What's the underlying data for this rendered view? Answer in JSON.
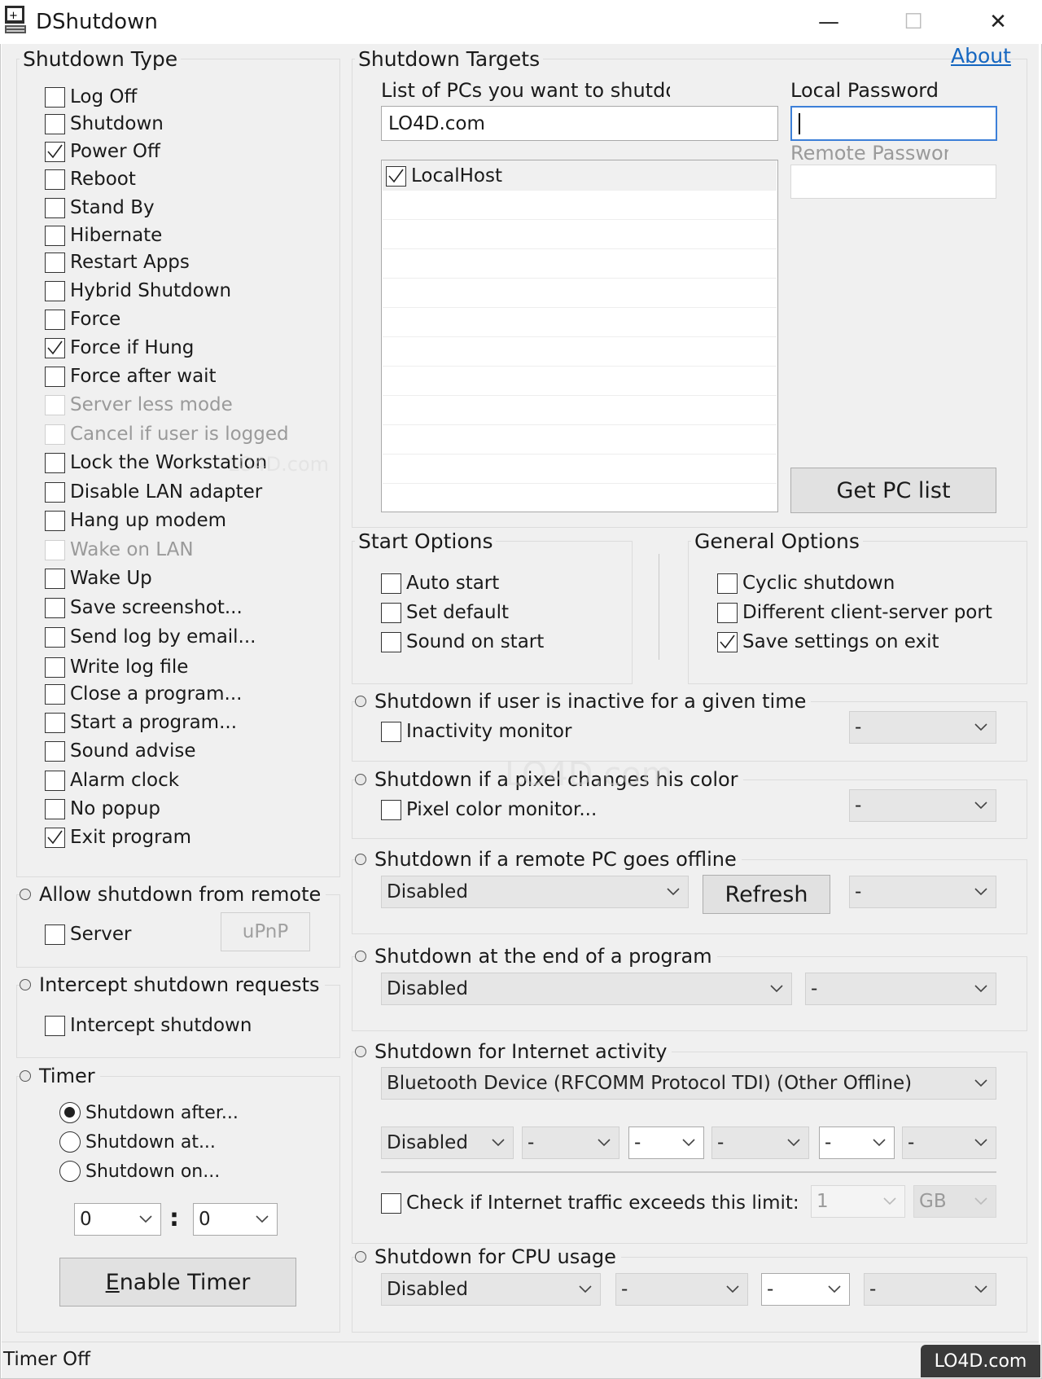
{
  "window": {
    "title": "DShutdown",
    "minimize_glyph": "—",
    "maximize_glyph": "☐",
    "close_glyph": "✕"
  },
  "shutdown_type": {
    "title": "Shutdown Type",
    "items": [
      {
        "label": "Log Off",
        "checked": false,
        "disabled": false
      },
      {
        "label": "Shutdown",
        "checked": false,
        "disabled": false
      },
      {
        "label": "Power Off",
        "checked": true,
        "disabled": false
      },
      {
        "label": "Reboot",
        "checked": false,
        "disabled": false
      },
      {
        "label": "Stand By",
        "checked": false,
        "disabled": false
      },
      {
        "label": "Hibernate",
        "checked": false,
        "disabled": false
      },
      {
        "label": "Restart Apps",
        "checked": false,
        "disabled": false
      },
      {
        "label": "Hybrid Shutdown",
        "checked": false,
        "disabled": false
      },
      {
        "label": "Force",
        "checked": false,
        "disabled": false
      },
      {
        "label": "Force if Hung",
        "checked": true,
        "disabled": false
      },
      {
        "label": "Force after wait",
        "checked": false,
        "disabled": false
      },
      {
        "label": "Server less mode",
        "checked": false,
        "disabled": true
      },
      {
        "label": "Cancel if user is logged",
        "checked": false,
        "disabled": true
      },
      {
        "label": "Lock the Workstation",
        "checked": false,
        "disabled": false
      },
      {
        "label": "Disable LAN adapter",
        "checked": false,
        "disabled": false
      },
      {
        "label": "Hang up modem",
        "checked": false,
        "disabled": false
      },
      {
        "label": "Wake on LAN",
        "checked": false,
        "disabled": true
      },
      {
        "label": "Wake Up",
        "checked": false,
        "disabled": false
      },
      {
        "label": "Save screenshot...",
        "checked": false,
        "disabled": false
      },
      {
        "label": "Send log by email...",
        "checked": false,
        "disabled": false
      },
      {
        "label": "Write log file",
        "checked": false,
        "disabled": false
      },
      {
        "label": "Close a program...",
        "checked": false,
        "disabled": false
      },
      {
        "label": "Start a program...",
        "checked": false,
        "disabled": false
      },
      {
        "label": "Sound advise",
        "checked": false,
        "disabled": false
      },
      {
        "label": "Alarm clock",
        "checked": false,
        "disabled": false
      },
      {
        "label": "No popup",
        "checked": false,
        "disabled": false
      },
      {
        "label": "Exit program",
        "checked": true,
        "disabled": false
      }
    ]
  },
  "allow_remote": {
    "title": "Allow shutdown from remote",
    "server_label": "Server",
    "upnp_label": "uPnP"
  },
  "intercept": {
    "title": "Intercept shutdown requests",
    "checkbox_label": "Intercept shutdown"
  },
  "timer": {
    "title": "Timer",
    "options": [
      {
        "label": "Shutdown after...",
        "selected": true
      },
      {
        "label": "Shutdown at...",
        "selected": false
      },
      {
        "label": "Shutdown on...",
        "selected": false
      }
    ],
    "hours": "0",
    "separator": ":",
    "minutes": "0",
    "enable_label": "Enable Timer",
    "enable_label_accel": "E",
    "enable_label_rest": "nable Timer"
  },
  "targets": {
    "title": "Shutdown Targets",
    "about_label": "About",
    "list_label": "List of PCs you want to shutdow",
    "pc_input_value": "LO4D.com",
    "local_password_label": "Local Password",
    "local_password_value": "",
    "remote_password_label": "Remote Passworc",
    "remote_password_value": "",
    "pcs": [
      {
        "label": "LocalHost",
        "checked": true
      }
    ],
    "get_pc_list_label": "Get PC list"
  },
  "start_options": {
    "title": "Start Options",
    "items": [
      {
        "label": "Auto start",
        "checked": false
      },
      {
        "label": "Set default",
        "checked": false
      },
      {
        "label": "Sound on start",
        "checked": false
      }
    ]
  },
  "general_options": {
    "title": "General Options",
    "items": [
      {
        "label": "Cyclic shutdown",
        "checked": false
      },
      {
        "label": "Different client-server port",
        "checked": false
      },
      {
        "label": "Save settings on exit",
        "checked": true
      }
    ]
  },
  "inactive": {
    "title": "Shutdown if user is inactive for a given time",
    "checkbox_label": "Inactivity monitor",
    "combo_value": "-"
  },
  "pixel": {
    "title": "Shutdown if a pixel changes his color",
    "checkbox_label": "Pixel color monitor...",
    "combo_value": "-"
  },
  "remote_offline": {
    "title": "Shutdown if a remote PC goes offline",
    "combo_value": "Disabled",
    "refresh_label": "Refresh",
    "combo2_value": "-"
  },
  "end_program": {
    "title": "Shutdown at the end of a program",
    "combo_value": "Disabled",
    "combo2_value": "-"
  },
  "internet": {
    "title": "Shutdown for Internet activity",
    "device_value": "Bluetooth Device (RFCOMM Protocol TDI) (Other Offline)",
    "mode_value": "Disabled",
    "c1": "-",
    "c2": "-",
    "c3": "-",
    "c4": "-",
    "c5": "-",
    "limit_label": "Check if Internet traffic exceeds this limit:",
    "limit_value": "1",
    "unit_value": "GB"
  },
  "cpu": {
    "title": "Shutdown for CPU usage",
    "mode_value": "Disabled",
    "c1": "-",
    "c2": "-",
    "c3": "-"
  },
  "status": {
    "text": "Timer Off"
  },
  "watermark": {
    "text": "LO4D.com"
  }
}
